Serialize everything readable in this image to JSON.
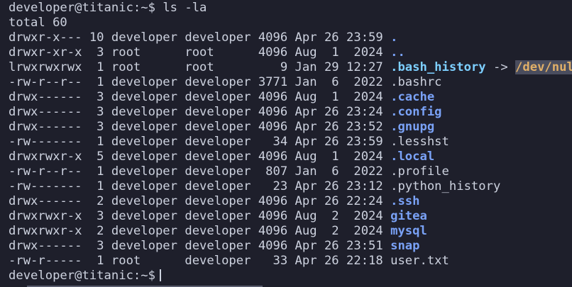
{
  "terminal": {
    "prompt": "developer@titanic:~$",
    "command": " ls -la",
    "total": "total 60",
    "entries": [
      {
        "meta": "drwxr-x--- 10 developer developer 4096 Apr 26 23:59 ",
        "name": ".",
        "kind": "dir"
      },
      {
        "meta": "drwxr-xr-x  3 root      root      4096 Aug  1  2024 ",
        "name": "..",
        "kind": "dir"
      },
      {
        "meta": "lrwxrwxrwx  1 root      root         9 Jan 29 12:27 ",
        "name": ".bash_history",
        "kind": "link",
        "arrow": " -> ",
        "target": "/dev/null"
      },
      {
        "meta": "-rw-r--r--  1 developer developer 3771 Jan  6  2022 ",
        "name": ".bashrc",
        "kind": "file"
      },
      {
        "meta": "drwx------  3 developer developer 4096 Aug  1  2024 ",
        "name": ".cache",
        "kind": "dir"
      },
      {
        "meta": "drwx------  3 developer developer 4096 Apr 26 23:24 ",
        "name": ".config",
        "kind": "dir"
      },
      {
        "meta": "drwx------  3 developer developer 4096 Apr 26 23:52 ",
        "name": ".gnupg",
        "kind": "dir"
      },
      {
        "meta": "-rw-------  1 developer developer   34 Apr 26 23:59 ",
        "name": ".lesshst",
        "kind": "file"
      },
      {
        "meta": "drwxrwxr-x  5 developer developer 4096 Aug  1  2024 ",
        "name": ".local",
        "kind": "dir"
      },
      {
        "meta": "-rw-r--r--  1 developer developer  807 Jan  6  2022 ",
        "name": ".profile",
        "kind": "file"
      },
      {
        "meta": "-rw-------  1 developer developer   23 Apr 26 23:12 ",
        "name": ".python_history",
        "kind": "file"
      },
      {
        "meta": "drwx------  2 developer developer 4096 Apr 26 22:24 ",
        "name": ".ssh",
        "kind": "dir"
      },
      {
        "meta": "drwxrwxr-x  3 developer developer 4096 Aug  2  2024 ",
        "name": "gitea",
        "kind": "dir"
      },
      {
        "meta": "drwxrwxr-x  2 developer developer 4096 Aug  2  2024 ",
        "name": "mysql",
        "kind": "dir"
      },
      {
        "meta": "drwx------  3 developer developer 4096 Apr 26 23:51 ",
        "name": "snap",
        "kind": "dir"
      },
      {
        "meta": "-rw-r-----  1 root      developer   33 Apr 26 22:18 ",
        "name": "user.txt",
        "kind": "file"
      }
    ],
    "final_prompt": "developer@titanic:~$"
  },
  "colors": {
    "background": "#1e1f2b",
    "text": "#cdd2df",
    "directory": "#7aa2f7",
    "symlink": "#7dcfff",
    "symlink_target": "#e0af68"
  }
}
